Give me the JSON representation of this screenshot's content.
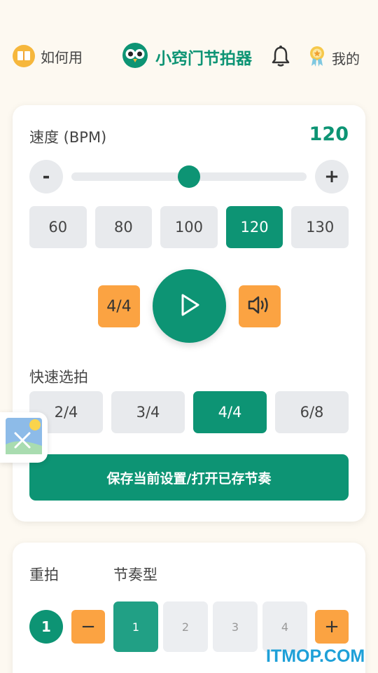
{
  "header": {
    "how_to_use": "如何用",
    "app_title": "小窍门节拍器",
    "mine": "我的"
  },
  "tempo": {
    "label": "速度 (BPM)",
    "value": "120",
    "minus": "-",
    "plus": "+",
    "slider_fraction": 0.5,
    "presets": [
      "60",
      "80",
      "100",
      "120",
      "130"
    ],
    "active_preset": "120"
  },
  "controls": {
    "time_signature": "4/4"
  },
  "quick_beats": {
    "label": "快速选拍",
    "options": [
      "2/4",
      "3/4",
      "4/4",
      "6/8"
    ],
    "active": "4/4"
  },
  "save_button": "保存当前设置/打开已存节奏",
  "rhythm": {
    "accent_label": "重拍",
    "pattern_label": "节奏型",
    "accent_value": "1",
    "decrease": "−",
    "increase": "+",
    "beats": [
      "1",
      "2",
      "3",
      "4"
    ],
    "active_beat": "1"
  },
  "watermark": "ITMOP.COM",
  "colors": {
    "primary": "#0d9474",
    "accent": "#fba342",
    "background": "#fdf9f1"
  }
}
